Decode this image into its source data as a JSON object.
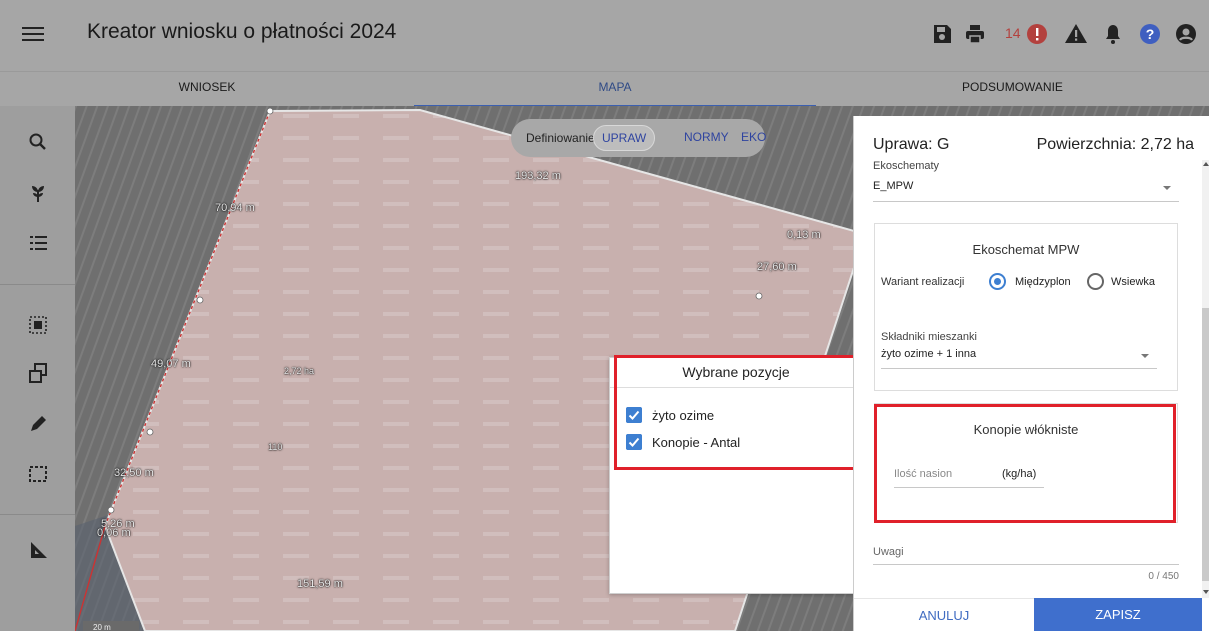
{
  "app": {
    "title": "Kreator wniosku o płatności 2024",
    "alert_count": "14"
  },
  "tabs": [
    {
      "label": "WNIOSEK"
    },
    {
      "label": "MAPA"
    },
    {
      "label": "PODSUMOWANIE"
    }
  ],
  "mode_selector": {
    "label": "Definiowanie",
    "options": [
      "UPRAW",
      "NORMY",
      "EKO"
    ],
    "selected": "UPRAW"
  },
  "map": {
    "dimensions": [
      "193,32 m",
      "70,94 m",
      "0,13 m",
      "27,60 m",
      "49,07 m",
      "32,50 m",
      "5,26 m",
      "0,06 m",
      "151,59 m"
    ],
    "area_label": "2,72 ha",
    "point_label": "110",
    "scale_label": "20 m"
  },
  "popup": {
    "title": "Wybrane pozycje",
    "items": [
      {
        "label": "żyto ozime",
        "checked": true
      },
      {
        "label": "Konopie - Antal",
        "checked": true
      }
    ]
  },
  "panel": {
    "crop_label": "Uprawa: G",
    "area_label": "Powierzchnia: 2,72 ha",
    "ekoschematy_label": "Ekoschematy",
    "ekoschematy_value": "E_MPW",
    "eko_card": {
      "title": "Ekoschemat MPW",
      "variant_label": "Wariant realizacji",
      "options": [
        "Międzyplon",
        "Wsiewka"
      ],
      "selected": "Międzyplon",
      "mix_label": "Składniki mieszanki",
      "mix_value": "żyto ozime + 1 inna"
    },
    "konopie_card": {
      "title": "Konopie włókniste",
      "seed_label": "Ilość nasion",
      "seed_unit": "(kg/ha)"
    },
    "notes_label": "Uwagi",
    "notes_counter": "0 / 450",
    "cancel_label": "ANULUJ",
    "save_label": "ZAPISZ"
  },
  "colors": {
    "accent": "#3f6fcd",
    "highlight_box": "#e0202a",
    "alert": "#b3413e"
  },
  "icons": [
    "menu-icon",
    "save-icon",
    "print-icon",
    "alert-icon",
    "warning-icon",
    "bell-icon",
    "help-icon",
    "account-icon",
    "search-icon",
    "plant-icon",
    "list-icon",
    "select-area-icon",
    "copy-shape-icon",
    "edit-icon",
    "dashed-select-icon",
    "measure-icon"
  ]
}
